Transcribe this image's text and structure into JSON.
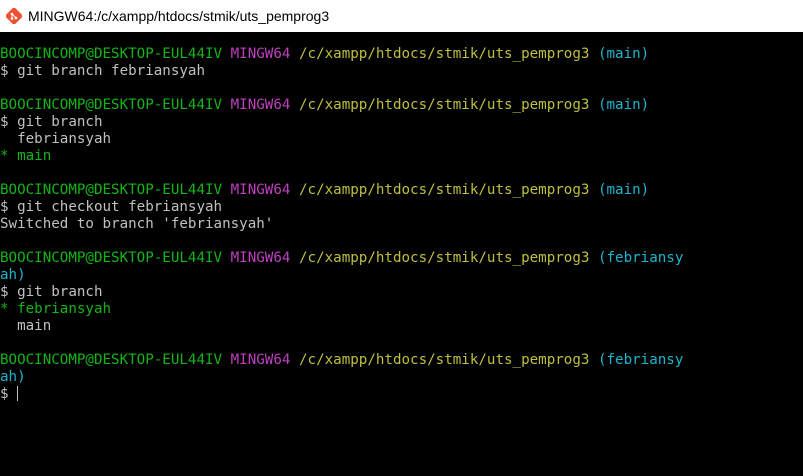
{
  "window": {
    "title": "MINGW64:/c/xampp/htdocs/stmik/uts_pemprog3",
    "icon": "git-bash-icon"
  },
  "colors": {
    "user_host": "#12b516",
    "shell_name": "#bf3fbf",
    "path": "#bfbf3f",
    "branch": "#1fb4cf",
    "text": "#c0c0c0",
    "current_branch": "#12b516"
  },
  "terminal": {
    "blocks": [
      {
        "prompt": {
          "user": "BOOCINCOMP@DESKTOP-EUL44IV",
          "shell": "MINGW64",
          "path": "/c/xampp/htdocs/stmik/uts_pemprog3",
          "branch": "(main)"
        },
        "command": "$ git branch febriansyah",
        "output": []
      },
      {
        "prompt": {
          "user": "BOOCINCOMP@DESKTOP-EUL44IV",
          "shell": "MINGW64",
          "path": "/c/xampp/htdocs/stmik/uts_pemprog3",
          "branch": "(main)"
        },
        "command": "$ git branch",
        "output": [
          "  febriansyah",
          "* main"
        ]
      },
      {
        "prompt": {
          "user": "BOOCINCOMP@DESKTOP-EUL44IV",
          "shell": "MINGW64",
          "path": "/c/xampp/htdocs/stmik/uts_pemprog3",
          "branch": "(main)"
        },
        "command": "$ git checkout febriansyah",
        "output": [
          "Switched to branch 'febriansyah'"
        ]
      },
      {
        "prompt": {
          "user": "BOOCINCOMP@DESKTOP-EUL44IV",
          "shell": "MINGW64",
          "path": "/c/xampp/htdocs/stmik/uts_pemprog3",
          "branch": "(febriansy",
          "branch_wrap": "ah)"
        },
        "command": "$ git branch",
        "output": [
          "* febriansyah",
          "  main"
        ]
      },
      {
        "prompt": {
          "user": "BOOCINCOMP@DESKTOP-EUL44IV",
          "shell": "MINGW64",
          "path": "/c/xampp/htdocs/stmik/uts_pemprog3",
          "branch": "(febriansy",
          "branch_wrap": "ah)"
        },
        "command": "$ ",
        "output": []
      }
    ]
  }
}
